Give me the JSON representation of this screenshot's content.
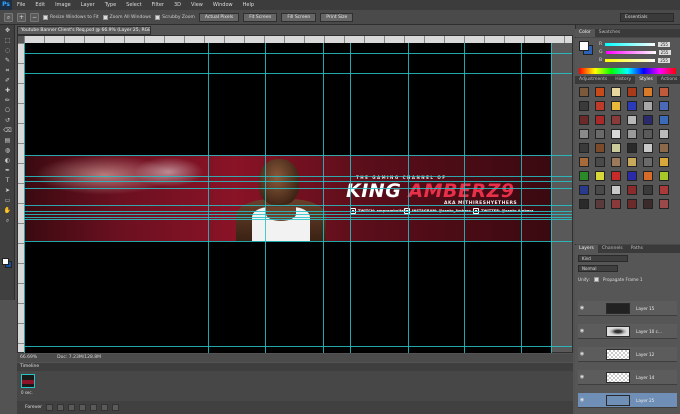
{
  "app": {
    "logo": "Ps",
    "menu": [
      "File",
      "Edit",
      "Image",
      "Layer",
      "Type",
      "Select",
      "Filter",
      "3D",
      "View",
      "Window",
      "Help"
    ]
  },
  "options_bar": {
    "resize_windows_label": "Resize Windows to Fit",
    "zoom_all_label": "Zoom All Windows",
    "scrubby_zoom_label": "Scrubby Zoom",
    "actual_pixels": "Actual Pixels",
    "fit_screen": "Fit Screen",
    "fill_screen": "Fill Screen",
    "print_size": "Print Size",
    "workspace": "Essentials"
  },
  "document": {
    "tab_title": "Youtube Banner Client's Req.psd @ 66.9% (Layer 25, RGB/8) *",
    "zoom": "66.69%",
    "doc_size": "Doc: 7.23M/128.8M"
  },
  "banner": {
    "small_text": "THE GAMING CHANNEL OF",
    "title_white": "KING",
    "title_red": "AMBERZ9",
    "subtitle": "AKA MITHIRESHYETHERS",
    "social": [
      {
        "icon": "twitch-icon",
        "label": "TWITCH: amprambultz8"
      },
      {
        "icon": "instagram-icon",
        "label": "INSTAGRAM: @santo_Amberz"
      },
      {
        "icon": "twitter-icon",
        "label": "TWITTER: @santo Amberz"
      }
    ]
  },
  "timeline": {
    "tab": "Timeline",
    "frame_time": "0 sec.",
    "loop": "Forever"
  },
  "color_panel": {
    "tabs": [
      "Color",
      "Swatches"
    ],
    "channels": [
      {
        "label": "R",
        "value": "255",
        "track": "linear-gradient(90deg,#00ffff,#ffffff)"
      },
      {
        "label": "G",
        "value": "255",
        "track": "linear-gradient(90deg,#ff00ff,#ffffff)"
      },
      {
        "label": "B",
        "value": "255",
        "track": "linear-gradient(90deg,#ffff00,#ffffff)"
      }
    ]
  },
  "styles_panel": {
    "tabs": [
      "Adjustments",
      "History",
      "Styles",
      "Actions"
    ],
    "swatches": [
      "#7a5a3a",
      "#c84a1a",
      "#e8d8a0",
      "#a83a1a",
      "#d87a2a",
      "#c05a3a",
      "#3a3a3a",
      "#c03a2a",
      "#e8b83a",
      "#2a3ab8",
      "#a8a8a8",
      "#4a6ab8",
      "#6a2a2a",
      "#a82a2a",
      "#8a3a3a",
      "#b8b8b8",
      "#2a2a6a",
      "#3a6ab8",
      "#8a8a8a",
      "#6a6a6a",
      "#d8d8d8",
      "#9a9a9a",
      "#5a5a5a",
      "#bababa",
      "#3a3a3a",
      "#7a4a2a",
      "#caca9a",
      "#2a2a2a",
      "#c8c8c8",
      "#8a6a4a",
      "#a86a3a",
      "#4a4a4a",
      "#9a7a5a",
      "#c8a85a",
      "#6a6a6a",
      "#d8a83a",
      "#2a8a2a",
      "#d8d83a",
      "#c82a2a",
      "#2a2aa8",
      "#d86a2a",
      "#a8c82a",
      "#2a3a8a",
      "#4a4a4a",
      "#c8c8c8",
      "#8a2a2a",
      "#3a3a3a",
      "#a83a3a",
      "#2a2a2a",
      "#5a3a3a",
      "#8a3a3a",
      "#6a2a2a",
      "#3a2a2a",
      "#9a4a4a"
    ]
  },
  "layers_panel": {
    "tabs": [
      "Layers",
      "Channels",
      "Paths"
    ],
    "kind_filter": "Kind",
    "blend_mode": "Normal",
    "unify_label": "Unify:",
    "propagate_label": "Propagate Frame 1",
    "layers": [
      {
        "name": "Layer 15",
        "thumb": "dark",
        "selected": false
      },
      {
        "name": "Layer 10 c...",
        "thumb": "eye-thumb",
        "selected": false
      },
      {
        "name": "Layer 12",
        "thumb": "trans",
        "selected": false
      },
      {
        "name": "Layer 14",
        "thumb": "trans",
        "selected": false
      },
      {
        "name": "Layer 25",
        "thumb": "photo",
        "selected": true
      }
    ]
  },
  "toolbar": {
    "tools": [
      "move-tool",
      "marquee-tool",
      "lasso-tool",
      "quick-select-tool",
      "crop-tool",
      "eyedropper-tool",
      "healing-tool",
      "brush-tool",
      "stamp-tool",
      "history-brush-tool",
      "eraser-tool",
      "gradient-tool",
      "blur-tool",
      "dodge-tool",
      "pen-tool",
      "type-tool",
      "path-select-tool",
      "shape-tool",
      "hand-tool",
      "zoom-tool"
    ],
    "glyphs": [
      "✥",
      "⬚",
      "◌",
      "✎",
      "⌗",
      "✐",
      "✚",
      "✏",
      "⎔",
      "↺",
      "⌫",
      "▤",
      "◍",
      "◐",
      "✒",
      "T",
      "➤",
      "▭",
      "✋",
      "⌕"
    ],
    "fg_color": "#ffffff",
    "bg_color": "#1a4ea0"
  }
}
